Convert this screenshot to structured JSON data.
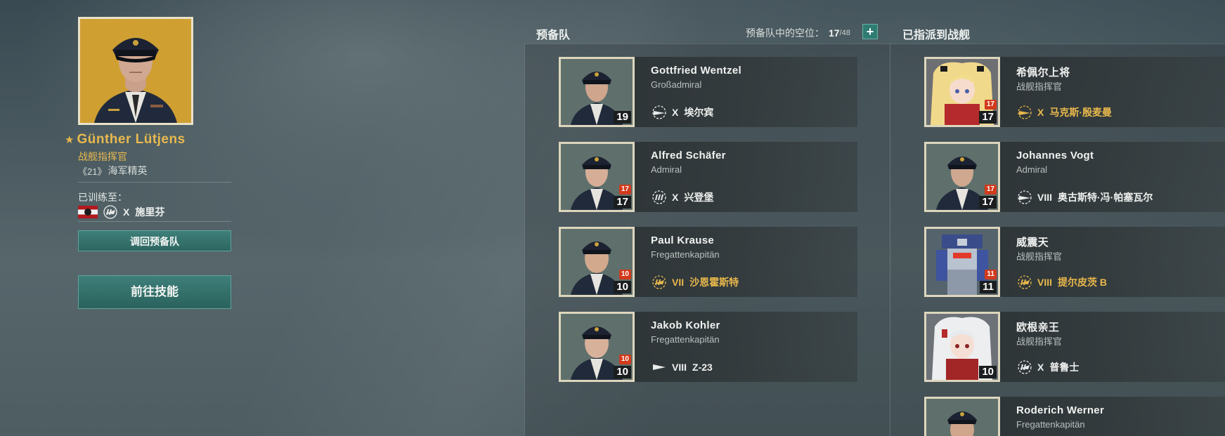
{
  "commander": {
    "name": "Günther  Lütjens",
    "rank": "战舰指挥官",
    "elite_level": "21",
    "elite_label": "海军精英",
    "trained_label": "已训练至：",
    "trained_ship_tier": "X",
    "trained_ship_name": "施里芬",
    "btn_return": "调回预备队",
    "btn_skills": "前往技能"
  },
  "reserve": {
    "title": "预备队",
    "slots_label": "预备队中的空位：",
    "slots_current": "17",
    "slots_max": "/48",
    "add_symbol": "+",
    "cards": [
      {
        "name": "Gottfried  Wentzel",
        "rank": "Großadmiral",
        "level": "19",
        "points": "",
        "ship_tier": "X",
        "ship_name": "埃尔宾",
        "ship_class": "cruiser-icon",
        "premium": false
      },
      {
        "name": "Alfred  Schäfer",
        "rank": "Admiral",
        "level": "17",
        "points": "17",
        "ship_tier": "X",
        "ship_name": "兴登堡",
        "ship_class": "cruiser-icon",
        "premium": false
      },
      {
        "name": "Paul  Krause",
        "rank": "Fregattenkapitän",
        "level": "10",
        "points": "10",
        "ship_tier": "VII",
        "ship_name": "沙恩霍斯特",
        "ship_class": "battleship-icon",
        "premium": true
      },
      {
        "name": "Jakob  Kohler",
        "rank": "Fregattenkapitän",
        "level": "10",
        "points": "10",
        "ship_tier": "VIII",
        "ship_name": "Z-23",
        "ship_class": "destroyer-icon",
        "premium": false
      }
    ]
  },
  "assigned": {
    "title": "已指派到战舰",
    "cards": [
      {
        "name": "希佩尔上将",
        "rank": "战舰指挥官",
        "level": "17",
        "points": "17",
        "ship_tier": "X",
        "ship_name": "马克斯·殷麦曼",
        "ship_class": "cruiser-icon",
        "premium": true
      },
      {
        "name": "Johannes  Vogt",
        "rank": "Admiral",
        "level": "17",
        "points": "17",
        "ship_tier": "VIII",
        "ship_name": "奥古斯特·冯·帕塞瓦尔",
        "ship_class": "cruiser-icon",
        "premium": false
      },
      {
        "name": "威震天",
        "rank": "战舰指挥官",
        "level": "11",
        "points": "11",
        "ship_tier": "VIII",
        "ship_name": "提尔皮茨 B",
        "ship_class": "battleship-icon",
        "premium": true
      },
      {
        "name": "欧根亲王",
        "rank": "战舰指挥官",
        "level": "10",
        "points": "",
        "ship_tier": "X",
        "ship_name": "普鲁士",
        "ship_class": "battleship-icon",
        "premium": false
      },
      {
        "name": "Roderich  Werner",
        "rank": "Fregattenkapitän",
        "level": "",
        "points": "",
        "ship_tier": "",
        "ship_name": "",
        "ship_class": "",
        "premium": false
      }
    ]
  },
  "colors": {
    "gold": "#e9b84c",
    "teal_button": "#2f7c73",
    "points_badge": "#d23a1c"
  }
}
